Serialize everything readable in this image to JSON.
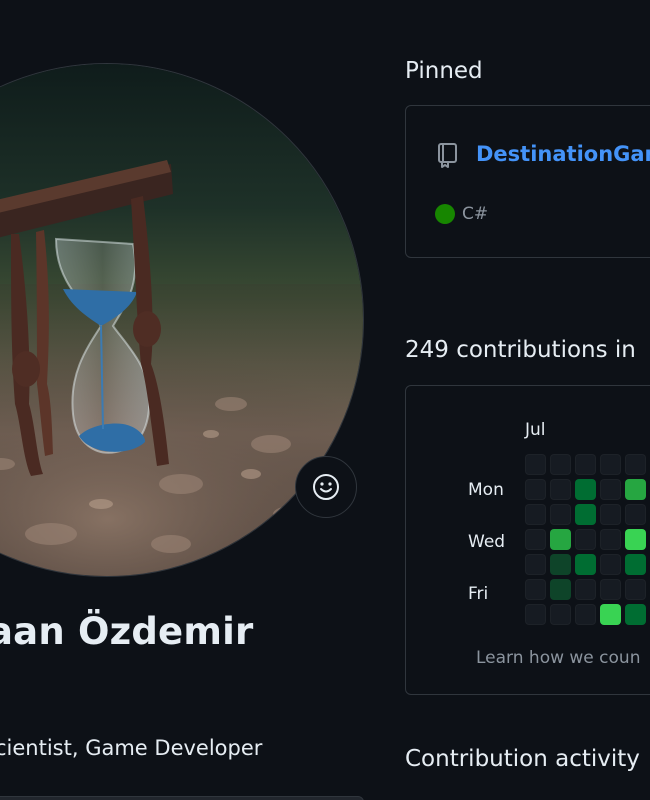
{
  "profile": {
    "name": "aan Özdemir",
    "bio": "cientist, Game Developer"
  },
  "pinned": {
    "title": "Pinned",
    "repo": {
      "name": "DestinationGam",
      "language": "C#",
      "language_color": "#178600"
    }
  },
  "contributions": {
    "heading": "249 contributions in",
    "month_label": "Jul",
    "day_labels": {
      "mon": "Mon",
      "wed": "Wed",
      "fri": "Fri"
    },
    "learn_link": "Learn how we coun",
    "grid_levels": [
      [
        0,
        0,
        0,
        0,
        0,
        0
      ],
      [
        0,
        0,
        2,
        0,
        3,
        0
      ],
      [
        0,
        0,
        2,
        0,
        0,
        0
      ],
      [
        0,
        3,
        0,
        0,
        4,
        0
      ],
      [
        0,
        1,
        2,
        0,
        2,
        0
      ],
      [
        0,
        1,
        0,
        0,
        0,
        0
      ],
      [
        0,
        0,
        0,
        4,
        2,
        0
      ]
    ],
    "level_colors": [
      "#161b22",
      "#0e4429",
      "#006d32",
      "#26a641",
      "#39d353"
    ]
  },
  "activity": {
    "heading": "Contribution activity"
  }
}
